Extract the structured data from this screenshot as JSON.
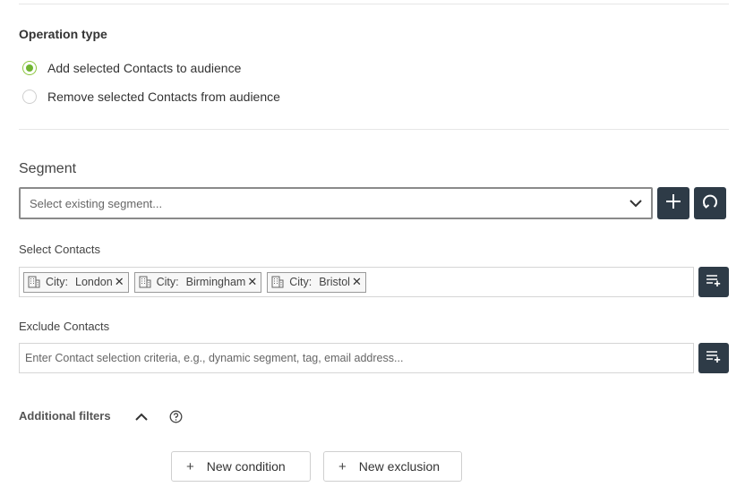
{
  "operation": {
    "title": "Operation type",
    "options": [
      {
        "label": "Add selected Contacts to audience",
        "selected": true
      },
      {
        "label": "Remove selected Contacts from audience",
        "selected": false
      }
    ]
  },
  "segment": {
    "title": "Segment",
    "placeholder": "Select existing segment..."
  },
  "select_contacts": {
    "label": "Select Contacts",
    "tags": [
      {
        "key": "City:",
        "value": "London"
      },
      {
        "key": "City:",
        "value": "Birmingham"
      },
      {
        "key": "City:",
        "value": "Bristol"
      }
    ],
    "remove_glyph": "✕"
  },
  "exclude_contacts": {
    "label": "Exclude Contacts",
    "placeholder": "Enter Contact selection criteria, e.g., dynamic segment, tag, email address..."
  },
  "additional_filters": {
    "label": "Additional filters",
    "new_condition": "New condition",
    "new_exclusion": "New exclusion",
    "plus_glyph": "+"
  },
  "icons": {
    "segment_add": "plus-icon",
    "segment_refresh": "refresh-icon",
    "criteria": "list-add-icon",
    "tag": "building-icon",
    "collapse": "chevron-up-icon",
    "help": "help-icon"
  },
  "colors": {
    "accent_green": "#6fb431",
    "dark_button": "#2e3b47"
  }
}
